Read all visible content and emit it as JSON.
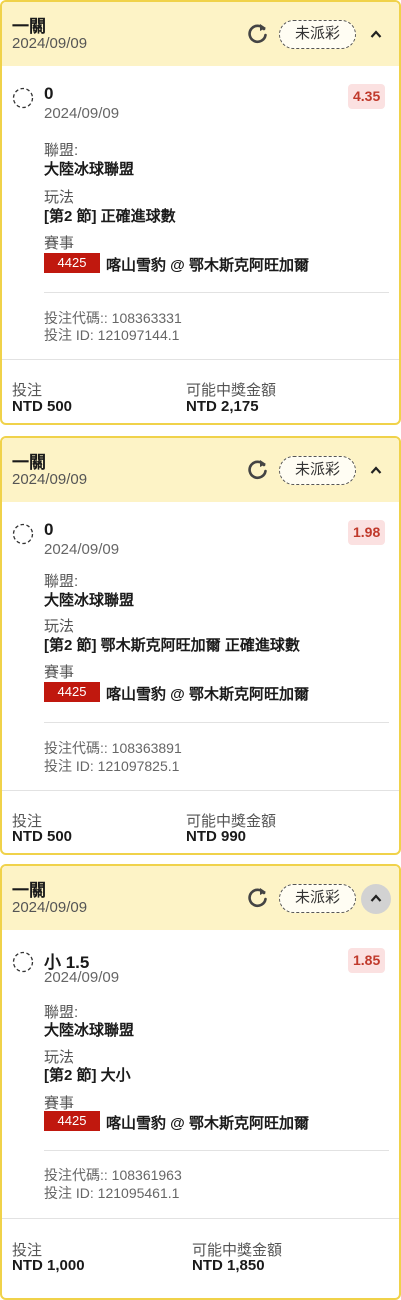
{
  "bets": [
    {
      "bet_type": "一關",
      "date": "2024/09/09",
      "status": "未派彩",
      "selection": "0",
      "selection_date": "2024/09/09",
      "odds": "4.35",
      "league_label": "聯盟:",
      "league": "大陸冰球聯盟",
      "market_label": "玩法",
      "market": "[第2 節] 正確進球數",
      "event_label": "賽事",
      "event_id": "4425",
      "event_name": "喀山雪豹 @ 鄂木斯克阿旺加爾",
      "bet_code": "投注代碼:: 108363331",
      "bet_id": "投注 ID: 121097144.1",
      "stake_label": "投注",
      "stake": "NTD 500",
      "payout_label": "可能中獎金額",
      "payout": "NTD 2,175"
    },
    {
      "bet_type": "一關",
      "date": "2024/09/09",
      "status": "未派彩",
      "selection": "0",
      "selection_date": "2024/09/09",
      "odds": "1.98",
      "league_label": "聯盟:",
      "league": "大陸冰球聯盟",
      "market_label": "玩法",
      "market": "[第2 節] 鄂木斯克阿旺加爾 正確進球數",
      "event_label": "賽事",
      "event_id": "4425",
      "event_name": "喀山雪豹 @ 鄂木斯克阿旺加爾",
      "bet_code": "投注代碼:: 108363891",
      "bet_id": "投注 ID: 121097825.1",
      "stake_label": "投注",
      "stake": "NTD 500",
      "payout_label": "可能中獎金額",
      "payout": "NTD 990"
    },
    {
      "bet_type": "一關",
      "date": "2024/09/09",
      "status": "未派彩",
      "selection": "小 1.5",
      "selection_date": "2024/09/09",
      "odds": "1.85",
      "league_label": "聯盟:",
      "league": "大陸冰球聯盟",
      "market_label": "玩法",
      "market": "[第2 節] 大小",
      "event_label": "賽事",
      "event_id": "4425",
      "event_name": "喀山雪豹 @ 鄂木斯克阿旺加爾",
      "bet_code": "投注代碼:: 108361963",
      "bet_id": "投注 ID: 121095461.1",
      "stake_label": "投注",
      "stake": "NTD 1,000",
      "payout_label": "可能中獎金額",
      "payout": "NTD 1,850"
    }
  ],
  "icons": {
    "refresh": "refresh-icon",
    "collapse": "chevron-up-icon",
    "selection": "dashed-circle-icon"
  },
  "colors": {
    "header_bg": "#fdf3c6",
    "card_border": "#f0d24a",
    "odds_text": "#c0392b",
    "odds_bg": "#fbe1e1",
    "event_badge": "#c0180e"
  }
}
